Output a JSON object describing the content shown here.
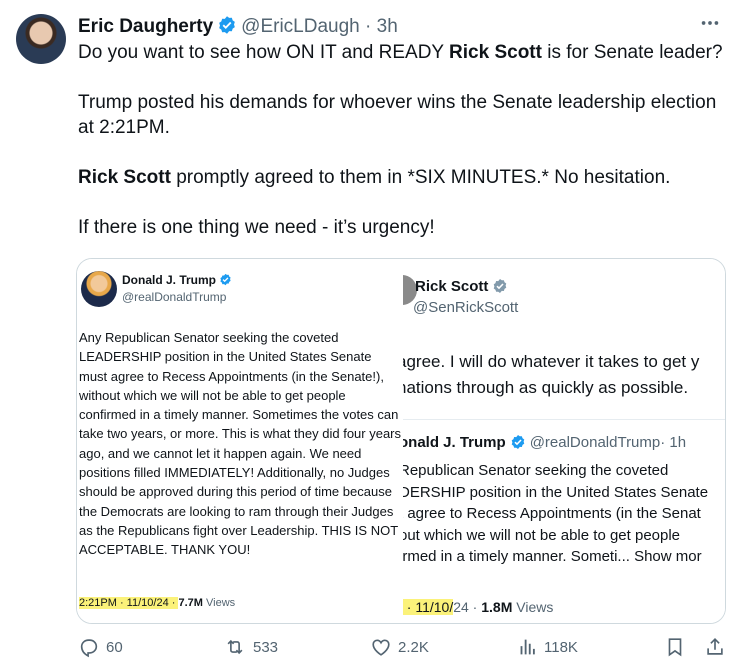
{
  "author": {
    "name": "Eric Daugherty",
    "handle": "@EricLDaugh",
    "time": "3h",
    "separator": "·"
  },
  "tweet": {
    "line1_pre": "Do you want to see how ON IT and READY ",
    "line1_bold": "Rick Scott",
    "line1_post": " is for Senate leader?",
    "para2": "Trump posted his demands for whoever wins the Senate leadership election at 2:21PM.",
    "para3_bold": "Rick Scott",
    "para3_post": " promptly agreed to them in *SIX MINUTES.* No hesitation.",
    "para4": "If there is one thing we need - it’s urgency!"
  },
  "trump_post": {
    "name": "Donald J. Trump",
    "handle": "@realDonaldTrump",
    "body": "Any Republican Senator seeking the coveted LEADERSHIP position in the United States Senate must agree to Recess Appointments (in the Senate!), without which we will not be able to get people confirmed in a timely manner. Sometimes the votes can take two years, or more. This is what they did four years ago, and we cannot let it happen again. We need positions filled IMMEDIATELY! Additionally, no Judges should be approved during this period of time because the Democrats are looking to ram through their Judges as the Republicans fight over Leadership. THIS IS NOT ACCEPTABLE. THANK YOU!",
    "time_date": "2:21PM · 11/10/24 · ",
    "views_count": "7.7M",
    "views_label": " Views"
  },
  "scott_post": {
    "name": "Rick Scott",
    "handle": "@SenRickScott",
    "line1": "agree. I will do whatever it takes to get y",
    "line2": "nations through as quickly as possible.",
    "quoted_name": "onald J. Trump",
    "quoted_handle": "@realDonaldTrump",
    "quoted_time": "· 1h",
    "quoted_lines": [
      "Republican Senator seeking the coveted",
      "DERSHIP position in the United States Senate",
      "t agree to Recess Appointments (in the Senat",
      "out which we will not be able to get people",
      "irmed in a timely manner. Someti... Show mor"
    ],
    "time_date": "/ · 11/10/",
    "time_rest": "24 · ",
    "views_count": "1.8M",
    "views_label": " Views"
  },
  "actions": {
    "replies": "60",
    "reposts": "533",
    "likes": "2.2K",
    "views": "118K"
  },
  "colors": {
    "verified": "#1d9bf0",
    "secondary_text": "#536471",
    "highlight": "#fbf27a",
    "border": "#cfd9de"
  },
  "icons": [
    "more-icon",
    "verified-icon",
    "reply-icon",
    "repost-icon",
    "like-icon",
    "views-icon",
    "bookmark-icon",
    "share-icon"
  ]
}
